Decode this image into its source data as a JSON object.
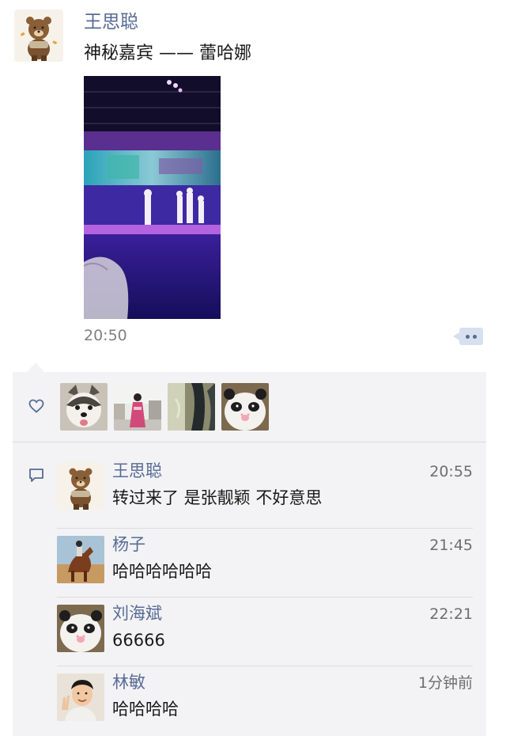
{
  "post": {
    "author": "王思聪",
    "text": "神秘嘉宾 —— 蕾哈娜",
    "time": "20:50",
    "avatar_icon": "bear-avatar-icon",
    "photo": "concert-stage-photo"
  },
  "likes": {
    "icon": "heart-outline-icon",
    "avatars": [
      "husky-dog-avatar",
      "girl-street-avatar",
      "sepia-photo-avatar",
      "panda-avatar"
    ]
  },
  "comments": [
    {
      "name": "王思聪",
      "time": "20:55",
      "text": "转过来了 是张靓颖 不好意思",
      "avatar": "bear-avatar-icon"
    },
    {
      "name": "杨子",
      "time": "21:45",
      "text": "哈哈哈哈哈哈",
      "avatar": "horse-rider-avatar"
    },
    {
      "name": "刘海斌",
      "time": "22:21",
      "text": "66666",
      "avatar": "panda-avatar"
    },
    {
      "name": "林敏",
      "time": "1分钟前",
      "text": "哈哈哈哈",
      "avatar": "man-peace-sign-avatar"
    }
  ],
  "colors": {
    "name_blue": "#576b95",
    "panel_bg": "#f3f3f5",
    "divider": "#dcdcdf"
  }
}
